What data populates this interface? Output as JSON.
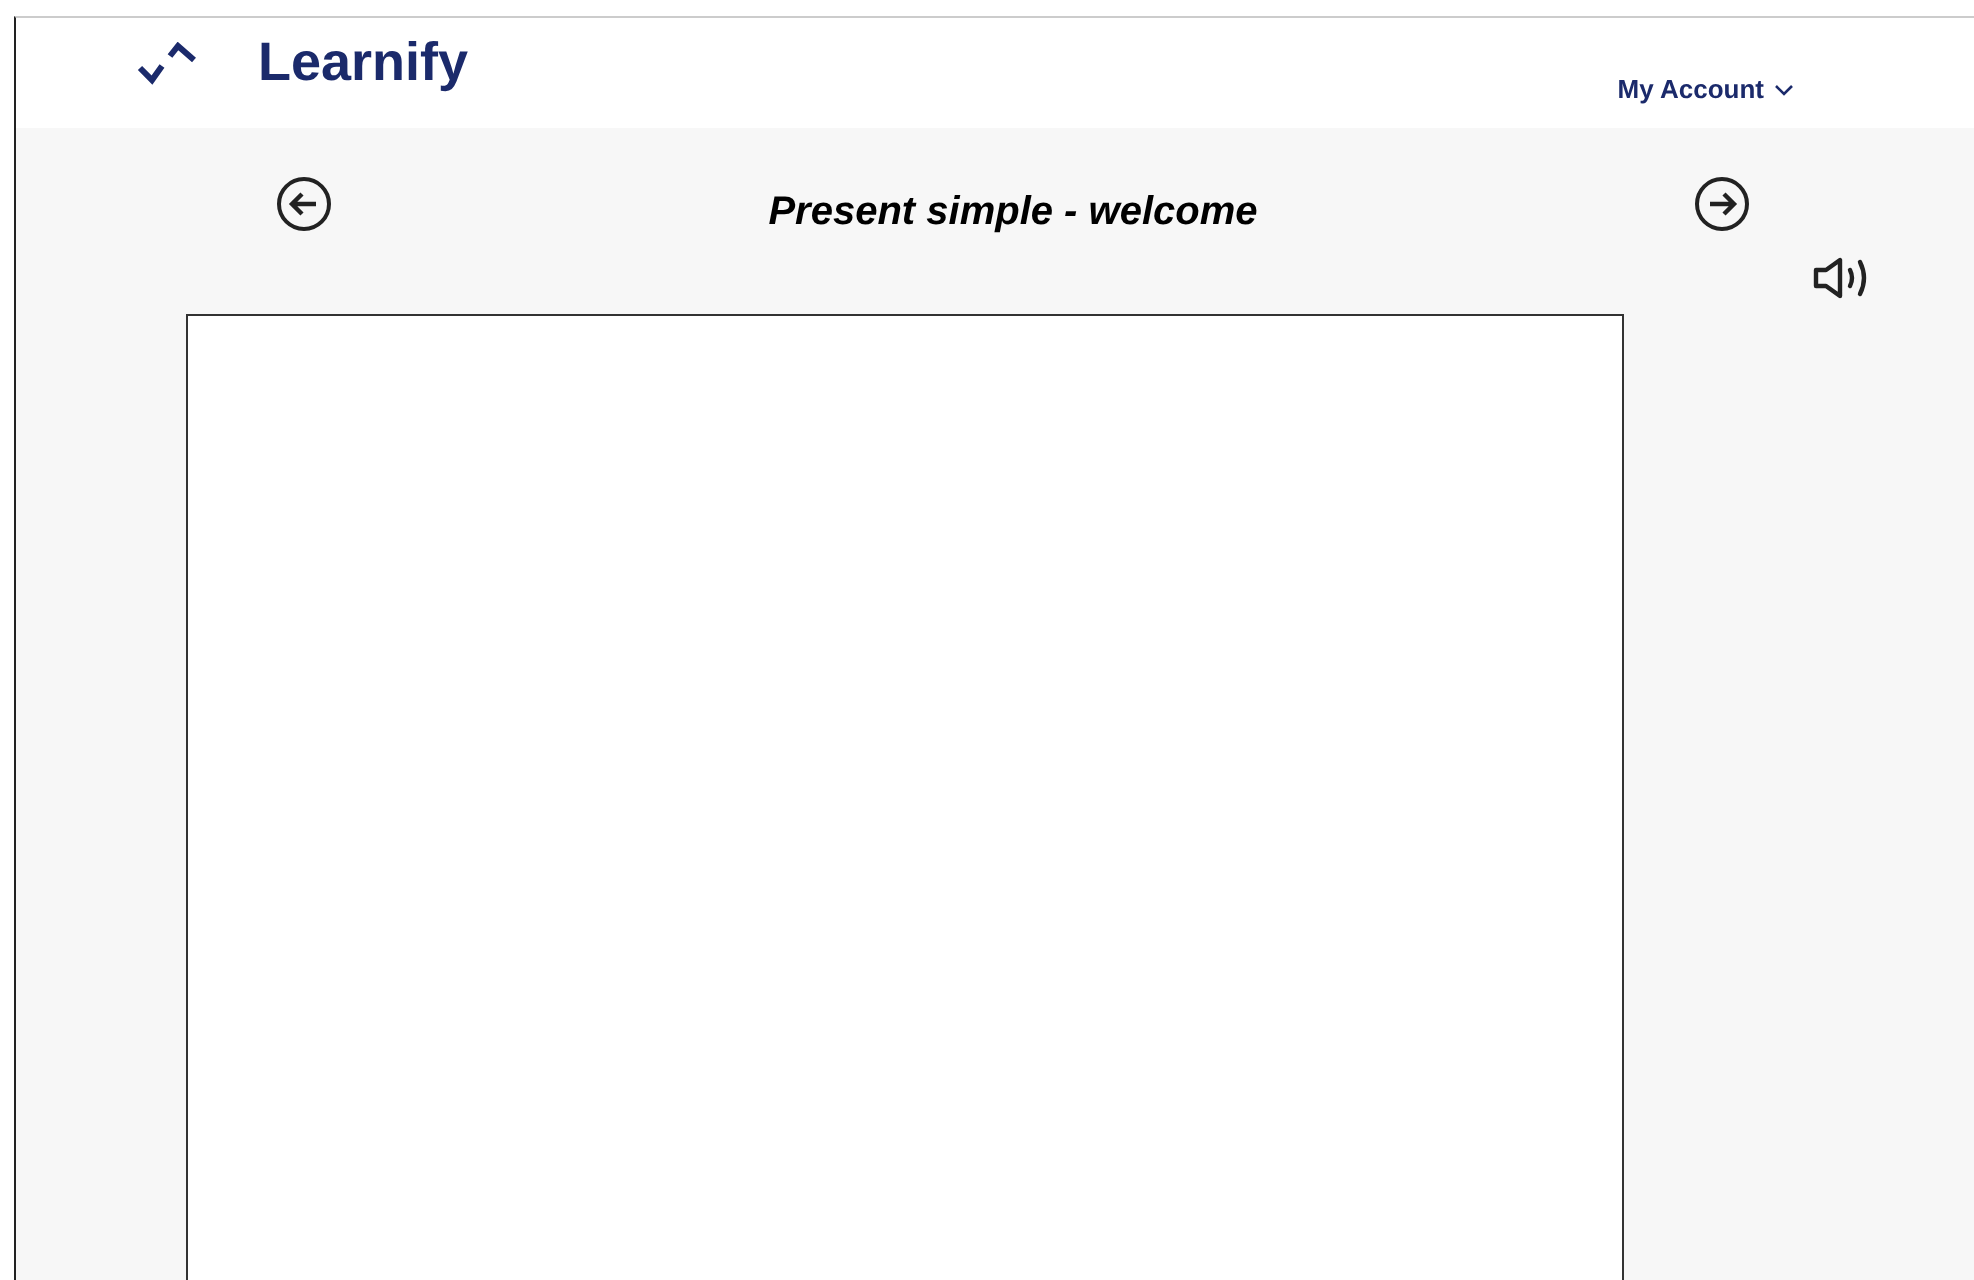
{
  "header": {
    "brand": "Learnify",
    "account_menu": "My Account"
  },
  "lesson": {
    "title": "Present simple - welcome"
  }
}
